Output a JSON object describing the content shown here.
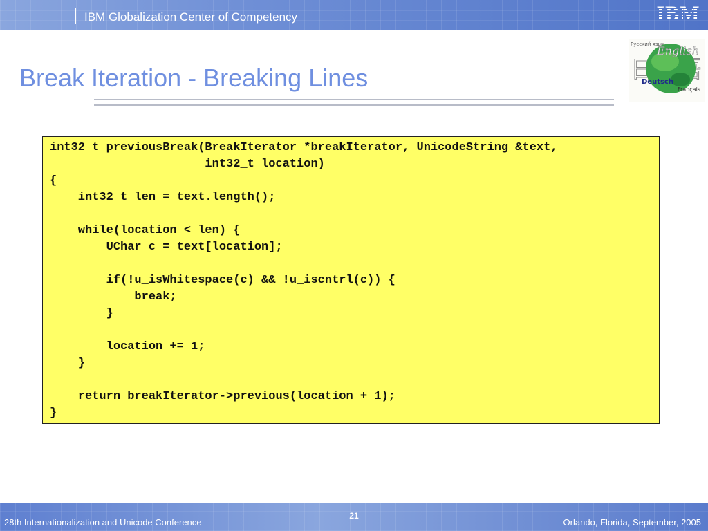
{
  "header": {
    "title": "IBM Globalization Center of Competency",
    "logo_text": "IBM"
  },
  "slide": {
    "title": "Break Iteration - Breaking Lines"
  },
  "globe_image": {
    "words": [
      "Русский язык",
      "English",
      "日本語",
      "Deutsch",
      "Français"
    ]
  },
  "code": {
    "lines": [
      "int32_t previousBreak(BreakIterator *breakIterator, UnicodeString &text,",
      "                      int32_t location)",
      "{",
      "    int32_t len = text.length();",
      "",
      "    while(location < len) {",
      "        UChar c = text[location];",
      "",
      "        if(!u_isWhitespace(c) && !u_iscntrl(c)) {",
      "            break;",
      "        }",
      "",
      "        location += 1;",
      "    }",
      "",
      "    return breakIterator->previous(location + 1);",
      "}"
    ]
  },
  "footer": {
    "conference": "28th Internationalization and Unicode Conference",
    "page_number": "21",
    "location": "Orlando, Florida, September, 2005"
  },
  "colors": {
    "header_blue": "#6f8fd6",
    "title_blue": "#6f8fe0",
    "code_background": "#ffff66"
  }
}
